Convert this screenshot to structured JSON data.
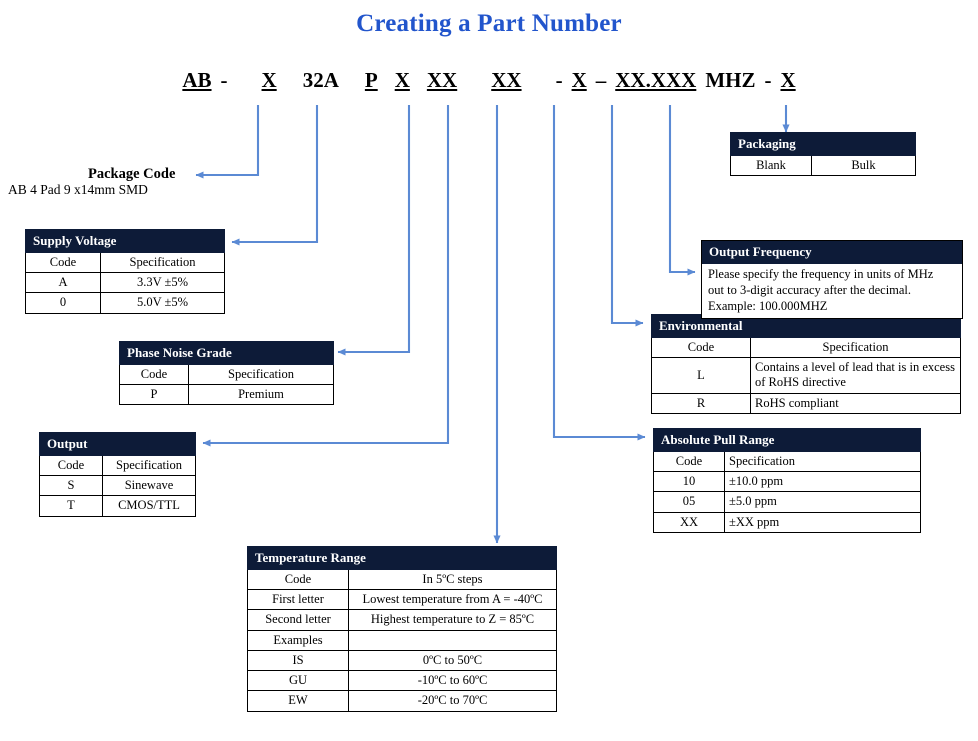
{
  "title": "Creating a Part Number",
  "part_number": {
    "segments": [
      {
        "text": "AB",
        "underline": true
      },
      {
        "text": "-",
        "underline": false
      },
      {
        "text": "X",
        "underline": true
      },
      {
        "text": "32A",
        "underline": false
      },
      {
        "text": "P",
        "underline": true
      },
      {
        "text": "X",
        "underline": true
      },
      {
        "text": "XX",
        "underline": true
      },
      {
        "text": "XX",
        "underline": true
      },
      {
        "text": "-",
        "underline": false
      },
      {
        "text": "X",
        "underline": true
      },
      {
        "text": "–",
        "underline": false
      },
      {
        "text": "XX.XXX",
        "underline": true
      },
      {
        "text": "MHZ",
        "underline": false
      },
      {
        "text": "-",
        "underline": false
      },
      {
        "text": "X",
        "underline": true
      }
    ]
  },
  "package_code": {
    "label": "Package Code",
    "description": "AB 4 Pad 9 x14mm SMD"
  },
  "supply_voltage": {
    "title": "Supply Voltage",
    "columns": [
      "Code",
      "Specification"
    ],
    "rows": [
      [
        "A",
        "3.3V ±5%"
      ],
      [
        "0",
        "5.0V ±5%"
      ]
    ]
  },
  "phase_noise_grade": {
    "title": "Phase Noise Grade",
    "columns": [
      "Code",
      "Specification"
    ],
    "rows": [
      [
        "P",
        "Premium"
      ]
    ]
  },
  "output": {
    "title": "Output",
    "columns": [
      "Code",
      "Specification"
    ],
    "rows": [
      [
        "S",
        "Sinewave"
      ],
      [
        "T",
        "CMOS/TTL"
      ]
    ]
  },
  "temperature_range": {
    "title": "Temperature Range",
    "columns": [
      "Code",
      "In 5ºC steps"
    ],
    "rows": [
      [
        "First letter",
        "Lowest temperature from A = -40ºC"
      ],
      [
        "Second  letter",
        "Highest temperature to Z = 85ºC"
      ],
      [
        "Examples",
        ""
      ],
      [
        "IS",
        "0ºC to 50ºC"
      ],
      [
        "GU",
        "-10ºC to 60ºC"
      ],
      [
        "EW",
        "-20ºC to 70ºC"
      ]
    ]
  },
  "absolute_pull_range": {
    "title": "Absolute Pull Range",
    "columns": [
      "Code",
      "Specification"
    ],
    "rows": [
      [
        "10",
        "±10.0 ppm"
      ],
      [
        "05",
        "±5.0 ppm"
      ],
      [
        "XX",
        "±XX ppm"
      ]
    ]
  },
  "environmental": {
    "title": "Environmental",
    "columns": [
      "Code",
      "Specification"
    ],
    "rows": [
      [
        "L",
        "Contains a level of lead that is in excess of RoHS directive"
      ],
      [
        "R",
        "RoHS compliant"
      ]
    ]
  },
  "output_frequency": {
    "title": "Output Frequency",
    "lines": [
      "Please specify the frequency in units of MHz",
      "out to 3-digit accuracy after the decimal.",
      "Example: 100.000MHZ"
    ]
  },
  "packaging": {
    "title": "Packaging",
    "cells": [
      "Blank",
      "Bulk"
    ]
  },
  "colors": {
    "title": "#2255cc",
    "header_bar": "#0d1b38",
    "connector": "#5b8ad4",
    "border": "#000000"
  }
}
